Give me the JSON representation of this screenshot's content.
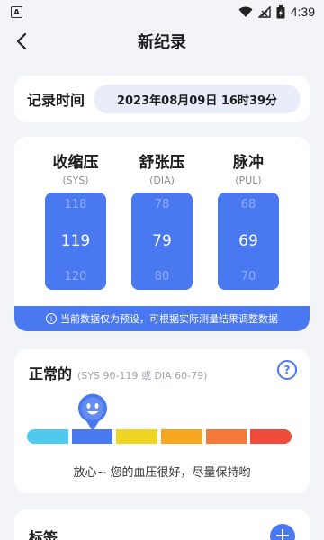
{
  "status_bar": {
    "notification_letter": "A",
    "time": "4:39",
    "battery_badge": "⚡"
  },
  "header": {
    "title": "新纪录"
  },
  "record_time": {
    "label": "记录时间",
    "value": "2023年08月09日 16时39分"
  },
  "blood_pressure": {
    "columns": [
      {
        "title": "收缩压",
        "sub": "(SYS)",
        "above": "118",
        "value": "119",
        "below": "120"
      },
      {
        "title": "舒张压",
        "sub": "(DIA)",
        "above": "78",
        "value": "79",
        "below": "80"
      },
      {
        "title": "脉冲",
        "sub": "(PUL)",
        "above": "68",
        "value": "69",
        "below": "70"
      }
    ],
    "notice": "当前数据仅为预设，可根据实际测量结果调整数据",
    "notice_icon": "i"
  },
  "status": {
    "title": "正常的",
    "range": "(SYS 90-119 或 DIA 60-79)",
    "help_icon": "?",
    "message": "放心~ 您的血压很好，尽量保持哟",
    "active_segment": 1,
    "scale_colors": [
      "#4fc9ee",
      "#4a78f0",
      "#eed523",
      "#f7a71f",
      "#f47a3a",
      "#f04a3a"
    ]
  },
  "tags": {
    "title": "标签",
    "add_icon": "+"
  },
  "colors": {
    "accent": "#4a78f0",
    "background": "#f3f4f8"
  }
}
